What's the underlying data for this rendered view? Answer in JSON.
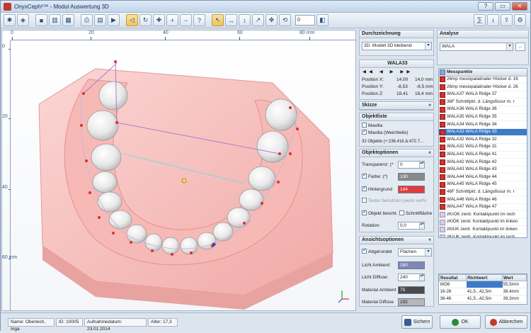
{
  "window": {
    "title": "OnyxCeph³™ - Modul Auswertung 3D",
    "help": "?",
    "min": "▭",
    "close": "✕"
  },
  "toolbar": {
    "zoom_value": "0"
  },
  "ruler": {
    "top_ticks": [
      "0",
      "20",
      "40",
      "60",
      "80 mm"
    ],
    "left_ticks": [
      "0",
      "20",
      "40",
      "60 mm"
    ]
  },
  "colors": {
    "teeth": "#f4f4f4",
    "gum": "#f3b3b0",
    "base": "#f7c3c1",
    "selection": "#3d7ac7",
    "farbe": "#888888",
    "hintergrund": "#e23b3b"
  },
  "durchzeichnung": {
    "title": "Durchzeichnung",
    "mode": "3D: Modell 3D bleibend"
  },
  "wala": {
    "title": "WALA33",
    "pos_x_label": "Position X:",
    "pos_x_a": "14,00",
    "pos_x_b": "14,0 mm",
    "pos_y_label": "Position Y:",
    "pos_y_a": "-8,53",
    "pos_y_b": "-8,5 mm",
    "pos_z_label": "Position Z:",
    "pos_z_a": "18,41",
    "pos_z_b": "18,4 mm"
  },
  "skizze": {
    "title": "Skizze"
  },
  "objektliste": {
    "title": "Objektliste",
    "item1": "Maxilla",
    "item2": "Maxilla (Weichteile)",
    "summary": "32 Objekte (+:236.416 Δ:472.7..."
  },
  "objektoptionen": {
    "title": "Objektoptionen",
    "transparenz_label": "Transparenz: (*",
    "transparenz": "0",
    "farbe_label": "Farbe: (*)",
    "farbe": "130",
    "hinter_label": "Hintergrund",
    "hinter": "144",
    "textur": "Textur benutzen (wenn verfü",
    "objekt": "Objekt beschr.",
    "schnitt": "Schnittfläche",
    "rotation_label": "Rotation:",
    "rotation": "0,0"
  },
  "ansicht": {
    "title": "Ansichtsoptionen",
    "abgerundet": "Abgerundet",
    "flaechen": "Flächen",
    "ambient_label": "Licht Ambient:",
    "ambient": "180",
    "diffuse_label": "Licht Diffuse:",
    "diffuse": "240",
    "mat_amb_label": "Material Ambient",
    "mat_amb": "75",
    "mat_dif_label": "Material Diffuse",
    "mat_dif": "192"
  },
  "analyse": {
    "title": "Analyse",
    "value": "WALA",
    "btn": "..."
  },
  "messpunkte": {
    "header": "Messpunkte",
    "items": [
      {
        "label": "26mp mesiopalatinaler Höcker d. 16",
        "type": "red"
      },
      {
        "label": "26mp mesiopalatinaler Höcker d. 26",
        "type": "red"
      },
      {
        "label": "WALA37 WALA Ridge 37",
        "type": "red"
      },
      {
        "label": "36F Schnittpkt. d. Längsfissur m. r",
        "type": "red"
      },
      {
        "label": "WALA36 WALA Ridge 36",
        "type": "red"
      },
      {
        "label": "WALA35 WALA Ridge 35",
        "type": "red"
      },
      {
        "label": "WALA34 WALA Ridge 34",
        "type": "red"
      },
      {
        "label": "WALA33 WALA Ridge 33",
        "type": "sel"
      },
      {
        "label": "WALA32 WALA Ridge 32",
        "type": "red"
      },
      {
        "label": "WALA31 WALA Ridge 31",
        "type": "red"
      },
      {
        "label": "WALA41 WALA Ridge 41",
        "type": "red"
      },
      {
        "label": "WALA42 WALA Ridge 42",
        "type": "red"
      },
      {
        "label": "WALA43 WALA Ridge 43",
        "type": "red"
      },
      {
        "label": "WALA44 WALA Ridge 44",
        "type": "red"
      },
      {
        "label": "WALA45 WALA Ridge 45",
        "type": "red"
      },
      {
        "label": "46F Schnittpkt. d. Längsfissur m. r",
        "type": "red"
      },
      {
        "label": "WALA46 WALA Ridge 46",
        "type": "red"
      },
      {
        "label": "WALA47 WALA Ridge 47",
        "type": "red"
      },
      {
        "label": "zKrOK zentr. Kontaktpunkt im rech",
        "type": "plain"
      },
      {
        "label": "zKlOK zentr. Kontaktpunkt im linken",
        "type": "plain"
      },
      {
        "label": "zKlUK zentr. Kontaktpunkt im linken",
        "type": "plain"
      },
      {
        "label": "zKrUK zentr. Kontaktpunkt im rech",
        "type": "plain"
      }
    ]
  },
  "results": {
    "headers": [
      "Resultat",
      "Richtwert",
      "Wert"
    ],
    "rows": [
      [
        "WD6",
        "",
        "55,5mm"
      ],
      [
        "16-26",
        "41,5...42,5m",
        "38,4mm"
      ],
      [
        "36-46",
        "41,5...42,5m",
        "39,3mm"
      ]
    ]
  },
  "status": {
    "name": "Name: Oberlech, Inga",
    "id": "ID: 10005",
    "date": "Aufnahmedatum: 23.01.2014",
    "alter": "Alter: 17,3"
  },
  "buttons": {
    "save": "Sichern",
    "ok": "OK",
    "cancel": "Abbrechen"
  }
}
